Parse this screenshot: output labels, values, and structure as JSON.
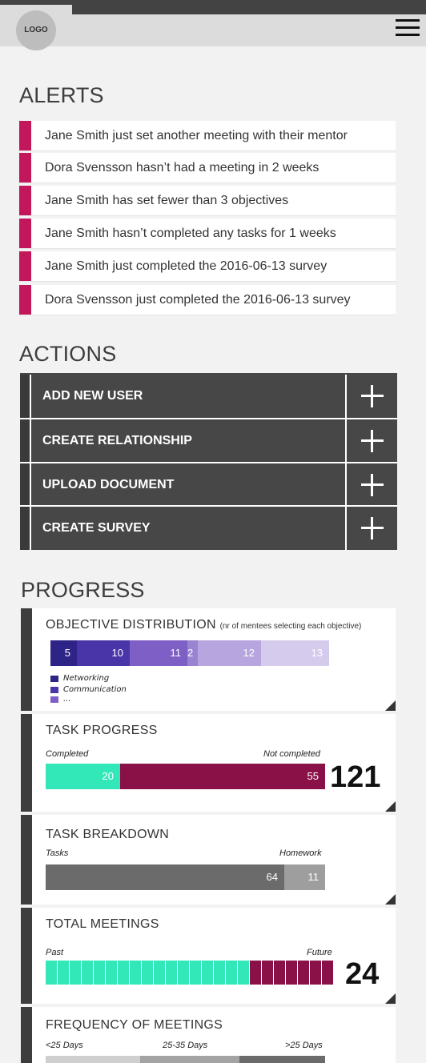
{
  "header": {
    "logo_text": "LOGO",
    "menu_icon": "hamburger-menu-icon"
  },
  "alerts": {
    "title": "ALERTS",
    "accent_color": "#c2185b",
    "items": [
      "Jane Smith just set another meeting with their mentor",
      "Dora Svensson hasn’t had a meeting in 2 weeks",
      "Jane Smith has set fewer than 3 objectives",
      "Jane Smith hasn’t completed any tasks for 1 weeks",
      "Jane Smith just completed the 2016-06-13 survey",
      "Dora Svensson just completed the 2016-06-13 survey"
    ]
  },
  "actions": {
    "title": "ACTIONS",
    "items": [
      {
        "label": "ADD NEW USER",
        "icon": "plus-icon"
      },
      {
        "label": "CREATE RELATIONSHIP",
        "icon": "plus-icon"
      },
      {
        "label": "UPLOAD DOCUMENT",
        "icon": "plus-icon"
      },
      {
        "label": "CREATE SURVEY",
        "icon": "plus-icon"
      }
    ]
  },
  "progress": {
    "title": "PROGRESS",
    "objective_distribution": {
      "title": "OBJECTIVE DISTRIBUTION",
      "subtitle": "(nr of mentees selecting each objective)",
      "values": [
        5,
        10,
        11,
        2,
        12,
        13
      ],
      "value_labels": [
        "5",
        "10",
        "11",
        "2",
        "12",
        "13"
      ],
      "colors": [
        "#2e2487",
        "#4a35a8",
        "#7e5fc5",
        "#9a83d1",
        "#b6a5de",
        "#d5cbec"
      ],
      "legend": [
        {
          "label": "Networking",
          "color": "#2e2487"
        },
        {
          "label": "Communication",
          "color": "#4a35a8"
        },
        {
          "label": "...",
          "color": "#7e5fc5"
        }
      ]
    },
    "task_progress": {
      "title": "TASK PROGRESS",
      "left_label": "Completed",
      "right_label": "Not completed",
      "completed": 20,
      "not_completed": 55,
      "completed_label": "20",
      "not_completed_label": "55",
      "completed_color": "#33e8b8",
      "not_completed_color": "#8a1148",
      "total": "121"
    },
    "task_breakdown": {
      "title": "TASK BREAKDOWN",
      "left_label": "Tasks",
      "right_label": "Homework",
      "tasks": 64,
      "homework": 11,
      "tasks_label": "64",
      "homework_label": "11",
      "tasks_color": "#6b6b6b",
      "homework_color": "#9e9e9e"
    },
    "total_meetings": {
      "title": "TOTAL MEETINGS",
      "left_label": "Past",
      "right_label": "Future",
      "past": 17,
      "future": 7,
      "past_color": "#33e8b8",
      "future_color": "#8a1148",
      "total": "24"
    },
    "frequency_of_meetings": {
      "title": "FREQUENCY OF MEETINGS",
      "labels": [
        "<25 Days",
        "25-35 Days",
        ">25 Days"
      ],
      "colors": [
        "#cfcfcf",
        "#a3a3a3",
        "#6b6b6b"
      ]
    }
  }
}
